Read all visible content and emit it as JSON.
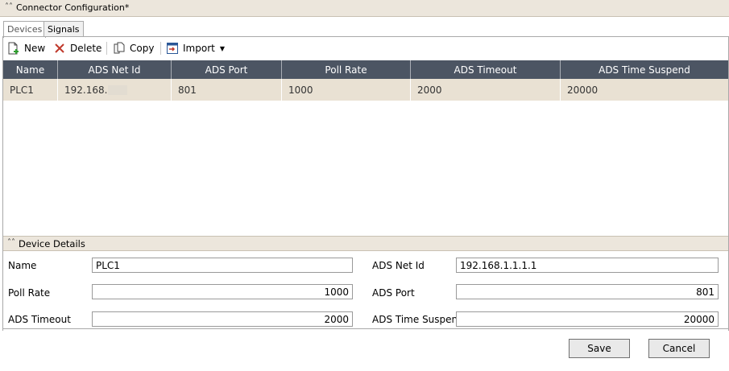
{
  "header": {
    "title": "Connector Configuration*"
  },
  "tabs": [
    {
      "label": "Devices"
    },
    {
      "label": "Signals"
    }
  ],
  "toolbar": {
    "new": "New",
    "delete": "Delete",
    "copy": "Copy",
    "import": "Import"
  },
  "grid": {
    "columns": [
      "Name",
      "ADS Net Id",
      "ADS Port",
      "Poll Rate",
      "ADS Timeout",
      "ADS Time Suspend"
    ],
    "rows": [
      {
        "name": "PLC1",
        "net_id": "192.168.",
        "port": "801",
        "poll_rate": "1000",
        "timeout": "2000",
        "time_suspend": "20000"
      }
    ]
  },
  "details": {
    "title": "Device Details",
    "name_label": "Name",
    "name_value": "PLC1",
    "poll_rate_label": "Poll Rate",
    "poll_rate_value": "1000",
    "timeout_label": "ADS Timeout",
    "timeout_value": "2000",
    "net_id_label": "ADS Net Id",
    "net_id_value": "192.168.1.1.1.1",
    "port_label": "ADS Port",
    "port_value": "801",
    "time_suspend_label": "ADS Time Suspend",
    "time_suspend_value": "20000"
  },
  "buttons": {
    "save": "Save",
    "cancel": "Cancel"
  }
}
